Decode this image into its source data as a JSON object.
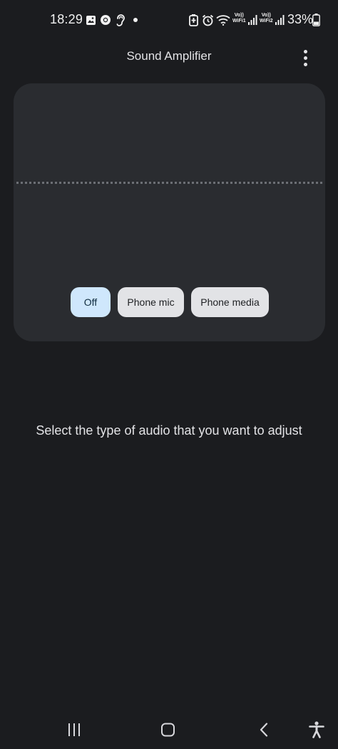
{
  "status_bar": {
    "time": "18:29",
    "volte1_top": "Vo))",
    "volte1_bottom": "WiFi1",
    "volte2_top": "Vo))",
    "volte2_bottom": "WiFi2",
    "battery_percent": "33%",
    "icons": [
      "gallery-icon",
      "chrome-icon",
      "hearing-icon",
      "notification-dot",
      "alarm-icon",
      "wifi-icon",
      "signal-icon",
      "battery-icon"
    ]
  },
  "app_bar": {
    "title": "Sound Amplifier"
  },
  "sources": {
    "options": [
      {
        "label": "Off",
        "selected": true
      },
      {
        "label": "Phone mic",
        "selected": false
      },
      {
        "label": "Phone media",
        "selected": false
      }
    ]
  },
  "hint": {
    "text": "Select the type of audio that you want to adjust"
  },
  "colors": {
    "background": "#1b1c1f",
    "card": "#2a2c30",
    "chip_selected": "#cfe7fc",
    "chip_default": "#e2e3e6"
  }
}
